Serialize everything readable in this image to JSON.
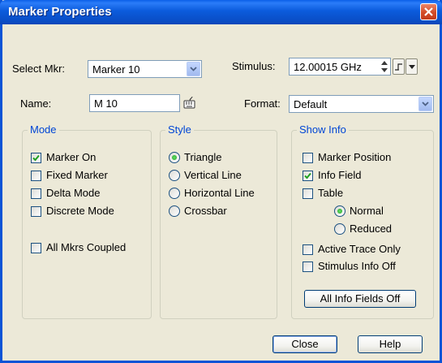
{
  "window": {
    "title": "Marker Properties"
  },
  "select_mkr": {
    "label": "Select Mkr:",
    "value": "Marker 10"
  },
  "stimulus": {
    "label": "Stimulus:",
    "value": "12.00015 GHz"
  },
  "name": {
    "label": "Name:",
    "value": "M 10"
  },
  "format": {
    "label": "Format:",
    "value": "Default"
  },
  "mode": {
    "title": "Mode",
    "items": [
      {
        "label": "Marker On",
        "checked": true
      },
      {
        "label": "Fixed Marker",
        "checked": false
      },
      {
        "label": "Delta Mode",
        "checked": false
      },
      {
        "label": "Discrete Mode",
        "checked": false
      }
    ],
    "coupled": {
      "label": "All Mkrs Coupled",
      "checked": false
    }
  },
  "style": {
    "title": "Style",
    "options": [
      {
        "label": "Triangle",
        "selected": true
      },
      {
        "label": "Vertical Line",
        "selected": false
      },
      {
        "label": "Horizontal Line",
        "selected": false
      },
      {
        "label": "Crossbar",
        "selected": false
      }
    ]
  },
  "show_info": {
    "title": "Show Info",
    "marker_position": {
      "label": "Marker Position",
      "checked": false
    },
    "info_field": {
      "label": "Info Field",
      "checked": true
    },
    "table": {
      "label": "Table",
      "checked": false
    },
    "normal": {
      "label": "Normal",
      "selected": true
    },
    "reduced": {
      "label": "Reduced",
      "selected": false
    },
    "active_trace_only": {
      "label": "Active Trace Only",
      "checked": false
    },
    "stimulus_info_off": {
      "label": "Stimulus Info Off",
      "checked": false
    },
    "all_off_button": "All Info Fields Off"
  },
  "buttons": {
    "close": "Close",
    "help": "Help"
  },
  "colors": {
    "title_bar": "#0a54d6",
    "group_title": "#0046d5",
    "check_mark": "#21a121",
    "close_button": "#d34a25"
  }
}
